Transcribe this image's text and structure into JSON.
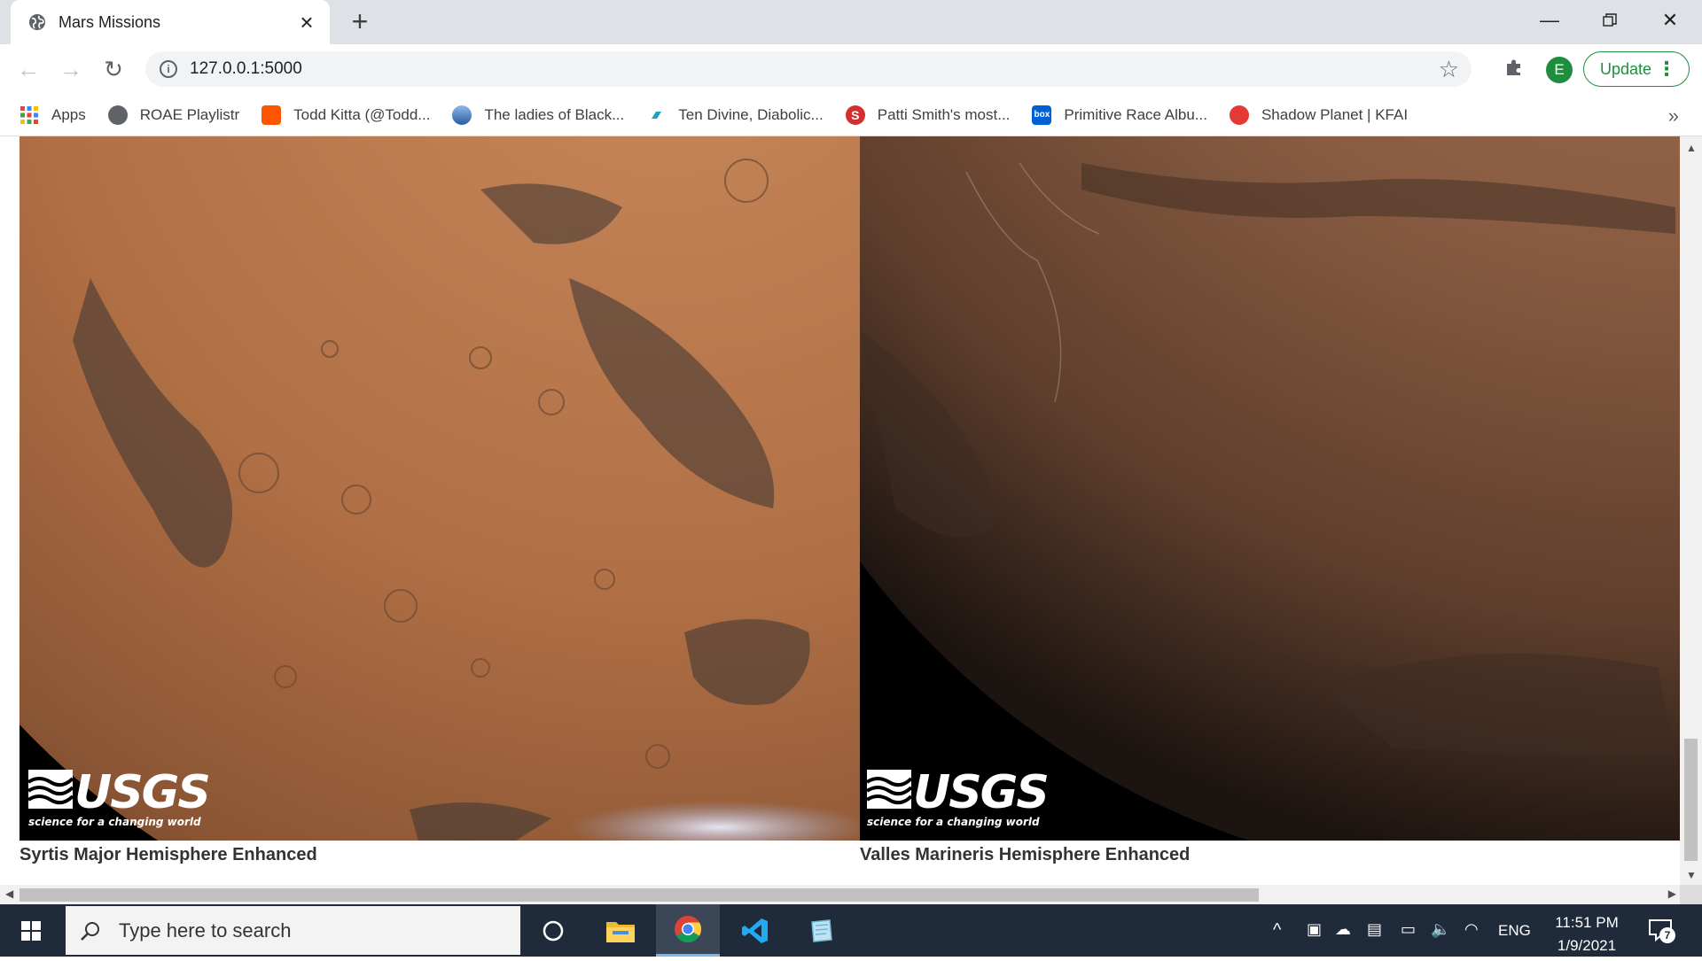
{
  "browser": {
    "tab_title": "Mars Missions",
    "url": "127.0.0.1:5000",
    "update_label": "Update",
    "profile_initial": "E"
  },
  "bookmarks": [
    {
      "label": "Apps",
      "icon": "apps-grid-icon",
      "color": "#4285f4"
    },
    {
      "label": "ROAE Playlistr",
      "icon": "globe-icon",
      "color": "#5f6368"
    },
    {
      "label": "Todd Kitta (@Todd...",
      "icon": "soundcloud-icon",
      "color": "#ff5500"
    },
    {
      "label": "The ladies of Black...",
      "icon": "planet-icon",
      "color": "#2a5d9f"
    },
    {
      "label": "Ten Divine, Diabolic...",
      "icon": "bandcamp-icon",
      "color": "#1da0c3"
    },
    {
      "label": "Patti Smith's most...",
      "icon": "s-logo-icon",
      "color": "#d32f2f"
    },
    {
      "label": "Primitive Race Albu...",
      "icon": "box-icon",
      "color": "#0061d5"
    },
    {
      "label": "Shadow Planet | KFAI",
      "icon": "ladybug-icon",
      "color": "#e53935"
    }
  ],
  "hemispheres": [
    {
      "caption": "Syrtis Major Hemisphere Enhanced",
      "logo_text": "USGS",
      "logo_tagline": "science for a changing world"
    },
    {
      "caption": "Valles Marineris Hemisphere Enhanced",
      "logo_text": "USGS",
      "logo_tagline": "science for a changing world"
    }
  ],
  "taskbar": {
    "search_placeholder": "Type here to search",
    "time": "11:51 PM",
    "date": "1/9/2021",
    "language": "ENG",
    "notification_count": "7"
  }
}
